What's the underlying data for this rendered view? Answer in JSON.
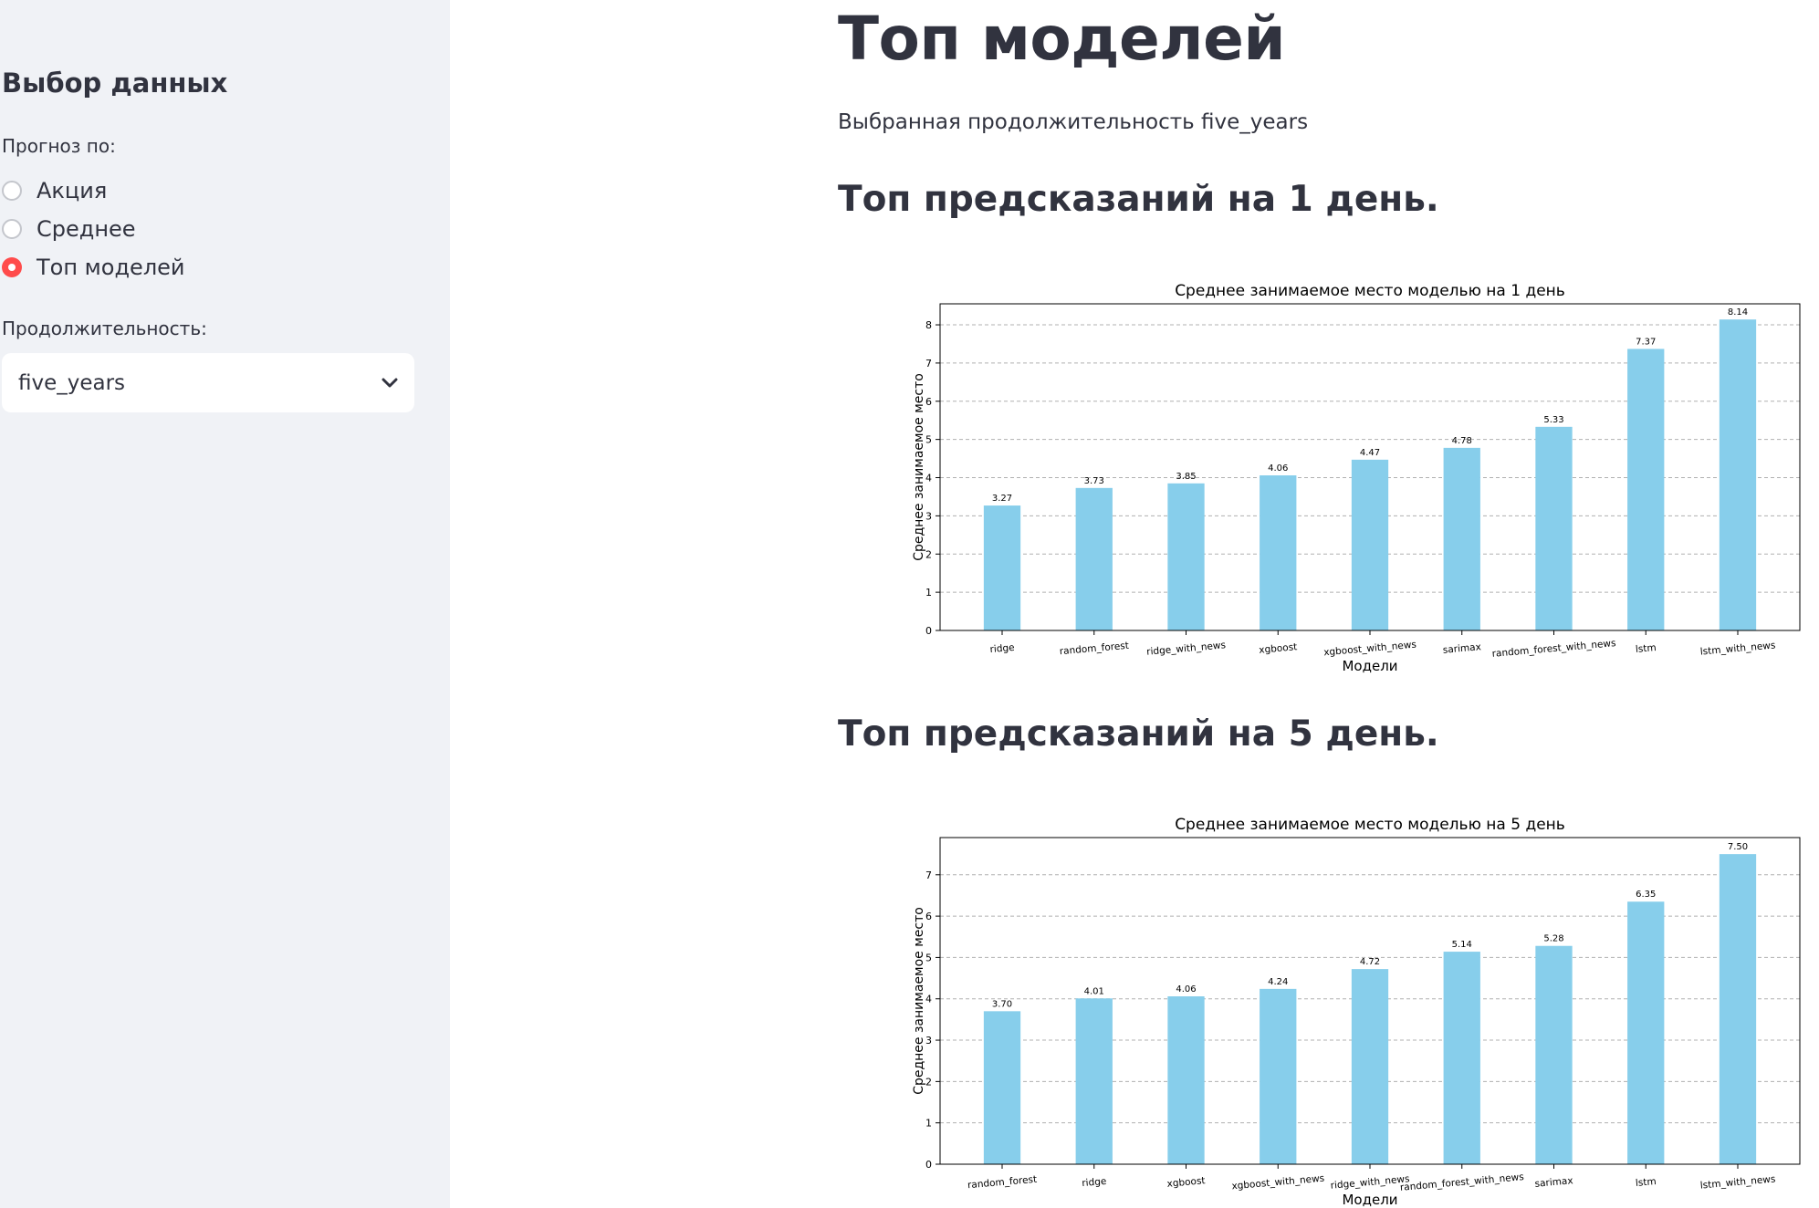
{
  "sidebar": {
    "header": "Выбор данных",
    "forecast_label": "Прогноз по:",
    "radio_options": [
      {
        "label": "Акция",
        "checked": false
      },
      {
        "label": "Среднее",
        "checked": false
      },
      {
        "label": "Топ моделей",
        "checked": true
      }
    ],
    "duration_label": "Продолжительность:",
    "duration_value": "five_years"
  },
  "main": {
    "title": "Топ моделей",
    "selected_text": "Выбранная продолжительность five_years",
    "section1": "Топ предсказаний на 1 день.",
    "section2": "Топ предсказаний на 5 день."
  },
  "colors": {
    "accent": "#ff4b4b",
    "bar": "#87ceeb"
  },
  "chart_data": [
    {
      "type": "bar",
      "title": "Среднее занимаемое место моделью на 1 день",
      "xlabel": "Модели",
      "ylabel": "Среднее занимаемое место",
      "categories": [
        "ridge",
        "random_forest",
        "ridge_with_news",
        "xgboost",
        "xgboost_with_news",
        "sarimax",
        "random_forest_with_news",
        "lstm",
        "lstm_with_news"
      ],
      "values": [
        3.27,
        3.73,
        3.85,
        4.06,
        4.47,
        4.78,
        5.33,
        7.37,
        8.14
      ],
      "value_labels": [
        "3.27",
        "3.73",
        "3.85",
        "4.06",
        "4.47",
        "4.78",
        "5.33",
        "7.37",
        "8.14"
      ],
      "yticks": [
        "0",
        "1",
        "2",
        "3",
        "4",
        "5",
        "6",
        "7",
        "8"
      ],
      "ylim": [
        0,
        8.55
      ],
      "grid": true
    },
    {
      "type": "bar",
      "title": "Среднее занимаемое место моделью на 5 день",
      "xlabel": "Модели",
      "ylabel": "Среднее занимаемое место",
      "categories": [
        "random_forest",
        "ridge",
        "xgboost",
        "xgboost_with_news",
        "ridge_with_news",
        "random_forest_with_news",
        "sarimax",
        "lstm",
        "lstm_with_news"
      ],
      "values": [
        3.7,
        4.01,
        4.06,
        4.24,
        4.72,
        5.14,
        5.28,
        6.35,
        7.5
      ],
      "value_labels": [
        "3.70",
        "4.01",
        "4.06",
        "4.24",
        "4.72",
        "5.14",
        "5.28",
        "6.35",
        "7.50"
      ],
      "yticks": [
        "0",
        "1",
        "2",
        "3",
        "4",
        "5",
        "6",
        "7"
      ],
      "ylim": [
        0,
        7.9
      ],
      "grid": true
    }
  ]
}
